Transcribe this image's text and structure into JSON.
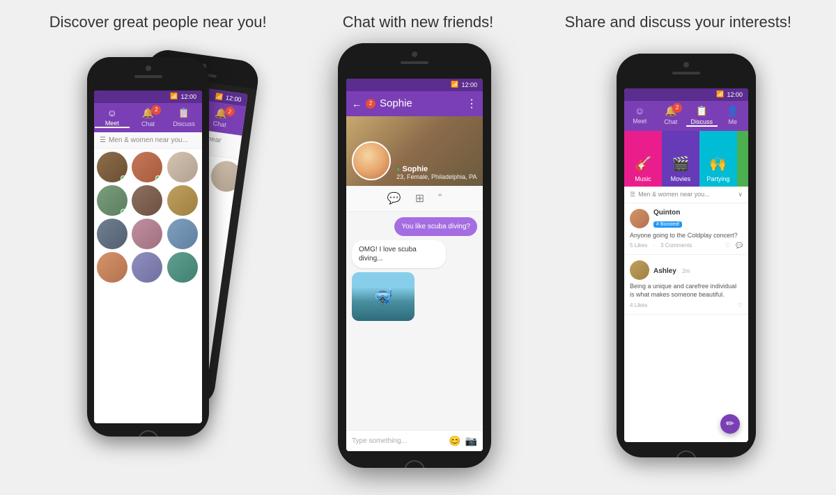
{
  "taglines": {
    "left": "Discover great people near you!",
    "center": "Chat with new friends!",
    "right": "Share and discuss your interests!"
  },
  "status_bar": {
    "wifi": "📶",
    "signal": "▌▌▌",
    "battery": "🔋",
    "time": "12:00"
  },
  "nav": {
    "meet_label": "Meet",
    "chat_label": "Chat",
    "discuss_label": "Discuss",
    "me_label": "Me",
    "badge_count": "2"
  },
  "phone1": {
    "search_placeholder": "Men & women near you...",
    "avatars": [
      "av1",
      "av2",
      "av3",
      "av4",
      "av5",
      "av6",
      "av7",
      "av8",
      "av9",
      "av10",
      "av11",
      "av12"
    ]
  },
  "phone2": {
    "chat_title": "Sophie",
    "badge_count": "2",
    "profile_name": "Sophie",
    "profile_online": "● Sophie",
    "profile_details": "23, Female, Philadelphia, PA",
    "message_sent": "You like scuba diving?",
    "message_received": "OMG! I love scuba diving...",
    "input_placeholder": "Type something..."
  },
  "phone3": {
    "categories": [
      {
        "name": "Music",
        "icon": "🎸",
        "color": "#e91e8c"
      },
      {
        "name": "Movies",
        "icon": "🎬",
        "color": "#673ab7"
      },
      {
        "name": "Partying",
        "icon": "🙌",
        "color": "#00bcd4"
      }
    ],
    "filter_label": "Men & women near you...",
    "posts": [
      {
        "user": "Quinton",
        "boosted": true,
        "boost_label": "# Boosted!",
        "time": "",
        "text": "Anyone going to the Coldplay concert?",
        "likes": "5 Likes",
        "dot": "·",
        "comments": "3 Comments"
      },
      {
        "user": "Ashley",
        "boosted": false,
        "time": "2m",
        "text": "Being a unique and carefree individual is what makes someone beautiful.",
        "likes": "4 Likes",
        "comments": ""
      }
    ],
    "fab_icon": "✏"
  }
}
